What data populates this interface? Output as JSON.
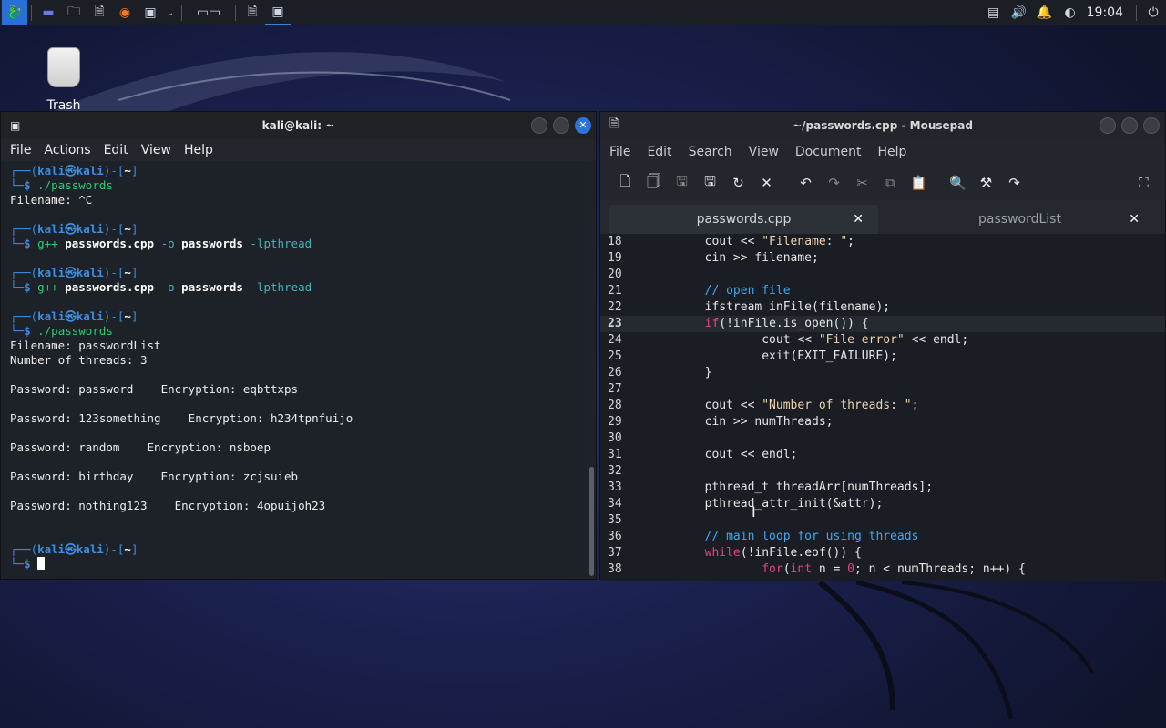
{
  "taskbar": {
    "clock": "19:04"
  },
  "desktop": {
    "trash_label": "Trash"
  },
  "terminal": {
    "title": "kali@kali: ~",
    "menu": [
      "File",
      "Actions",
      "Edit",
      "View",
      "Help"
    ],
    "prompt_user": "kali",
    "prompt_host": "kali",
    "prompt_dir": "~",
    "lines": [
      {
        "kind": "prompt"
      },
      {
        "kind": "cmd",
        "parts": [
          {
            "t": "./passwords",
            "c": "cmd"
          }
        ]
      },
      {
        "kind": "out",
        "text": "Filename: ^C"
      },
      {
        "kind": "blank"
      },
      {
        "kind": "prompt"
      },
      {
        "kind": "cmd",
        "parts": [
          {
            "t": "g++",
            "c": "cmd"
          },
          {
            "t": " passwords.cpp",
            "c": "arg"
          },
          {
            "t": " -o",
            "c": "flg"
          },
          {
            "t": " passwords",
            "c": "arg"
          },
          {
            "t": " -lpthread",
            "c": "flg"
          }
        ]
      },
      {
        "kind": "blank"
      },
      {
        "kind": "prompt"
      },
      {
        "kind": "cmd",
        "parts": [
          {
            "t": "g++",
            "c": "cmd"
          },
          {
            "t": " passwords.cpp",
            "c": "arg"
          },
          {
            "t": " -o",
            "c": "flg"
          },
          {
            "t": " passwords",
            "c": "arg"
          },
          {
            "t": " -lpthread",
            "c": "flg"
          }
        ]
      },
      {
        "kind": "blank"
      },
      {
        "kind": "prompt"
      },
      {
        "kind": "cmd",
        "parts": [
          {
            "t": "./passwords",
            "c": "cmd"
          }
        ]
      },
      {
        "kind": "out",
        "text": "Filename: passwordList"
      },
      {
        "kind": "out",
        "text": "Number of threads: 3"
      },
      {
        "kind": "blank"
      },
      {
        "kind": "out",
        "text": "Password: password    Encryption: eqbttxps"
      },
      {
        "kind": "blank"
      },
      {
        "kind": "out",
        "text": "Password: 123something    Encryption: h234tpnfuijo"
      },
      {
        "kind": "blank"
      },
      {
        "kind": "out",
        "text": "Password: random    Encryption: nsboep"
      },
      {
        "kind": "blank"
      },
      {
        "kind": "out",
        "text": "Password: birthday    Encryption: zcjsuieb"
      },
      {
        "kind": "blank"
      },
      {
        "kind": "out",
        "text": "Password: nothing123    Encryption: 4opuijoh23"
      },
      {
        "kind": "blank"
      },
      {
        "kind": "blank"
      },
      {
        "kind": "prompt"
      },
      {
        "kind": "input"
      }
    ]
  },
  "mousepad": {
    "title": "~/passwords.cpp - Mousepad",
    "menu": [
      "File",
      "Edit",
      "Search",
      "View",
      "Document",
      "Help"
    ],
    "tabs": [
      {
        "label": "passwords.cpp",
        "active": true
      },
      {
        "label": "passwordList",
        "active": false
      }
    ],
    "current_line": 23,
    "code": [
      {
        "n": 18,
        "t": [
          {
            "s": "        cout << "
          },
          {
            "s": "\"Filename: \"",
            "c": "str"
          },
          {
            "s": ";"
          }
        ]
      },
      {
        "n": 19,
        "t": [
          {
            "s": "        cin >> filename;"
          }
        ]
      },
      {
        "n": 20,
        "t": []
      },
      {
        "n": 21,
        "t": [
          {
            "s": "        // open file",
            "c": "cm"
          }
        ]
      },
      {
        "n": 22,
        "t": [
          {
            "s": "        ifstream inFile(filename);"
          }
        ]
      },
      {
        "n": 23,
        "t": [
          {
            "s": "        "
          },
          {
            "s": "if",
            "c": "kw"
          },
          {
            "s": "(!inFile.is_open()) {"
          }
        ]
      },
      {
        "n": 24,
        "t": [
          {
            "s": "                cout << "
          },
          {
            "s": "\"File error\"",
            "c": "str"
          },
          {
            "s": " << endl;"
          }
        ]
      },
      {
        "n": 25,
        "t": [
          {
            "s": "                exit(EXIT_FAILURE);"
          }
        ]
      },
      {
        "n": 26,
        "t": [
          {
            "s": "        }"
          }
        ]
      },
      {
        "n": 27,
        "t": []
      },
      {
        "n": 28,
        "t": [
          {
            "s": "        cout << "
          },
          {
            "s": "\"Number of threads: \"",
            "c": "str"
          },
          {
            "s": ";"
          }
        ]
      },
      {
        "n": 29,
        "t": [
          {
            "s": "        cin >> numThreads;"
          }
        ]
      },
      {
        "n": 30,
        "t": []
      },
      {
        "n": 31,
        "t": [
          {
            "s": "        cout << endl;"
          }
        ]
      },
      {
        "n": 32,
        "t": []
      },
      {
        "n": 33,
        "t": [
          {
            "s": "        pthread_t threadArr[numThreads];"
          }
        ]
      },
      {
        "n": 34,
        "t": [
          {
            "s": "        pthread_attr_init(&attr);"
          }
        ]
      },
      {
        "n": 35,
        "t": []
      },
      {
        "n": 36,
        "t": [
          {
            "s": "        // main loop for using threads",
            "c": "cm"
          }
        ]
      },
      {
        "n": 37,
        "t": [
          {
            "s": "        "
          },
          {
            "s": "while",
            "c": "kw"
          },
          {
            "s": "(!inFile.eof()) {"
          }
        ]
      },
      {
        "n": 38,
        "t": [
          {
            "s": "                "
          },
          {
            "s": "for",
            "c": "kw"
          },
          {
            "s": "("
          },
          {
            "s": "int",
            "c": "kw"
          },
          {
            "s": " n = "
          },
          {
            "s": "0",
            "c": "num"
          },
          {
            "s": "; n < numThreads; n++) {"
          }
        ]
      }
    ]
  }
}
